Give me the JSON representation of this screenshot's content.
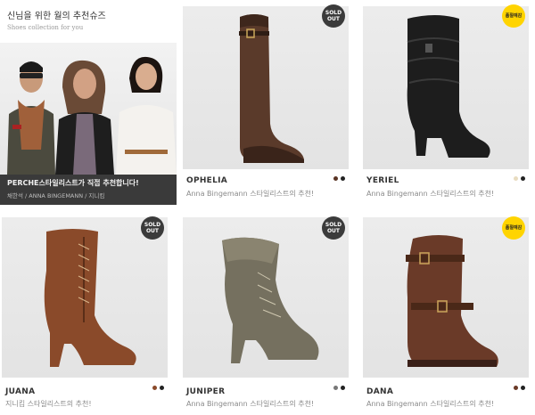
{
  "promo": {
    "title": "신님을 위한 월의 추천슈즈",
    "subtitle": "Shoes collection for you",
    "band_title": "PERCHE스타일리스트가 직접 추천합니다!",
    "band_names": "채한석 / ANNA BINGEMANN / 지니킴"
  },
  "products": [
    {
      "name": "OPHELIA",
      "desc": "Anna Bingemann 스타일리스트의 추천!",
      "badge": "SOLD\nOUT",
      "badge_type": "sold",
      "colors": [
        "#5a3424",
        "#222222"
      ]
    },
    {
      "name": "YERIEL",
      "desc": "Anna Bingemann 스타일리스트의 추천!",
      "badge": "품절예감",
      "badge_type": "low",
      "colors": [
        "#e8dcc0",
        "#222222"
      ]
    },
    {
      "name": "JUANA",
      "desc": "지니킴 스타일리스트의 추천!",
      "badge": "SOLD\nOUT",
      "badge_type": "sold",
      "colors": [
        "#8a4a2a",
        "#222222"
      ]
    },
    {
      "name": "JUNIPER",
      "desc": "Anna Bingemann 스타일리스트의 추천!",
      "badge": "SOLD\nOUT",
      "badge_type": "sold",
      "colors": [
        "#777777",
        "#222222"
      ]
    },
    {
      "name": "DANA",
      "desc": "Anna Bingemann 스타일리스트의 추천!",
      "badge": "품절예감",
      "badge_type": "low",
      "colors": [
        "#6a3a28",
        "#222222"
      ]
    }
  ]
}
